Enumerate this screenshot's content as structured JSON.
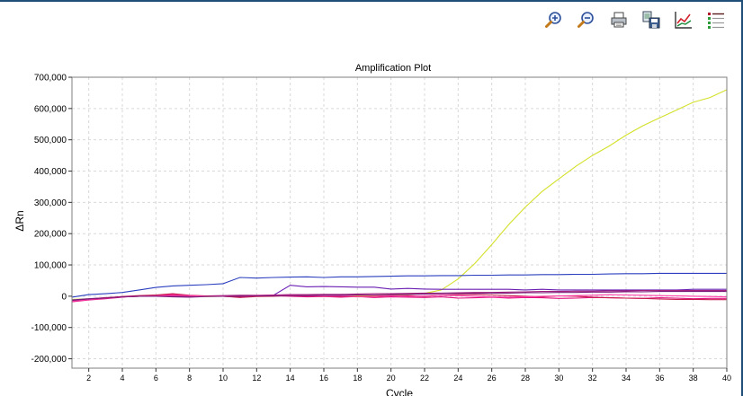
{
  "toolbar": {
    "icons": [
      "zoom-in-icon",
      "zoom-out-icon",
      "print-icon",
      "save-icon",
      "plot-settings-icon",
      "legend-icon"
    ]
  },
  "colors": {
    "grid": "#d9d9d9",
    "frame": "#000000",
    "background": "#ffffff"
  },
  "chart_data": {
    "type": "line",
    "title": "Amplification Plot",
    "xlabel": "Cycle",
    "ylabel": "ΔRn",
    "xlim": [
      1,
      40
    ],
    "ylim": [
      -230000,
      700000
    ],
    "xticks": [
      2,
      4,
      6,
      8,
      10,
      12,
      14,
      16,
      18,
      20,
      22,
      24,
      26,
      28,
      30,
      32,
      34,
      36,
      38,
      40
    ],
    "yticks": [
      -200000,
      -100000,
      0,
      100000,
      200000,
      300000,
      400000,
      500000,
      600000,
      700000
    ],
    "ytick_labels": [
      "-200,000",
      "-100,000",
      "0",
      "100,000",
      "200,000",
      "300,000",
      "400,000",
      "500,000",
      "600,000",
      "700,000"
    ],
    "grid": true,
    "legend": "none",
    "series": [
      {
        "color": "#d4e02a",
        "x": [
          1,
          2,
          3,
          4,
          5,
          6,
          7,
          8,
          9,
          10,
          11,
          12,
          13,
          14,
          15,
          16,
          17,
          18,
          19,
          20,
          21,
          22,
          23,
          24,
          25,
          26,
          27,
          28,
          29,
          30,
          31,
          32,
          33,
          34,
          35,
          36,
          37,
          38,
          39,
          40
        ],
        "y": [
          -10000,
          -8000,
          -6000,
          -2000,
          0,
          1000,
          2000,
          0,
          -1000,
          0,
          1000,
          0,
          1000,
          2000,
          0,
          -1000,
          0,
          1000,
          2000,
          3000,
          5000,
          9000,
          20000,
          55000,
          105000,
          165000,
          228000,
          285000,
          335000,
          375000,
          415000,
          450000,
          480000,
          515000,
          545000,
          570000,
          595000,
          620000,
          635000,
          660000
        ]
      },
      {
        "color": "#2b3fbf",
        "x": [
          1,
          2,
          3,
          4,
          5,
          6,
          7,
          8,
          9,
          10,
          11,
          12,
          13,
          14,
          15,
          16,
          17,
          18,
          19,
          20,
          21,
          22,
          23,
          24,
          25,
          26,
          27,
          28,
          29,
          30,
          31,
          32,
          33,
          34,
          35,
          36,
          37,
          38,
          39,
          40
        ],
        "y": [
          -3000,
          5000,
          8000,
          12000,
          20000,
          28000,
          33000,
          35000,
          37000,
          40000,
          60000,
          58000,
          60000,
          61000,
          62000,
          60000,
          62000,
          62000,
          63000,
          64000,
          65000,
          65000,
          66000,
          66000,
          67000,
          67000,
          68000,
          68000,
          69000,
          69000,
          70000,
          70000,
          71000,
          72000,
          72000,
          73000,
          73000,
          73000,
          73000,
          73000
        ]
      },
      {
        "color": "#6a1fb3",
        "x": [
          1,
          2,
          3,
          4,
          5,
          6,
          7,
          8,
          9,
          10,
          11,
          12,
          13,
          14,
          15,
          16,
          17,
          18,
          19,
          20,
          21,
          22,
          23,
          24,
          25,
          26,
          27,
          28,
          29,
          30,
          31,
          32,
          33,
          34,
          35,
          36,
          37,
          38,
          39,
          40
        ],
        "y": [
          -12000,
          -8000,
          -5000,
          -2000,
          0,
          0,
          0,
          0,
          1000,
          1000,
          2000,
          2000,
          3000,
          35000,
          30000,
          31000,
          30000,
          29000,
          29000,
          23000,
          25000,
          23000,
          22000,
          22000,
          22000,
          22000,
          22000,
          20000,
          22000,
          20000,
          20000,
          20000,
          20000,
          20000,
          20000,
          20000,
          20000,
          22000,
          22000,
          22000
        ]
      },
      {
        "color": "#a0207a",
        "x": [
          1,
          2,
          3,
          4,
          5,
          6,
          7,
          8,
          9,
          10,
          11,
          12,
          13,
          14,
          15,
          16,
          17,
          18,
          19,
          20,
          21,
          22,
          23,
          24,
          25,
          26,
          27,
          28,
          29,
          30,
          31,
          32,
          33,
          34,
          35,
          36,
          37,
          38,
          39,
          40
        ],
        "y": [
          -15000,
          -10000,
          -6000,
          -2000,
          0,
          2000,
          1000,
          0,
          1000,
          2000,
          3000,
          3000,
          4000,
          5000,
          5000,
          6000,
          6000,
          7000,
          8000,
          8000,
          9000,
          10000,
          10000,
          11000,
          12000,
          12000,
          13000,
          14000,
          15000,
          15000,
          16000,
          16000,
          17000,
          17000,
          18000,
          18000,
          18000,
          18000,
          18000,
          18000
        ]
      },
      {
        "color": "#e0117f",
        "x": [
          1,
          2,
          3,
          4,
          5,
          6,
          7,
          8,
          9,
          10,
          11,
          12,
          13,
          14,
          15,
          16,
          17,
          18,
          19,
          20,
          21,
          22,
          23,
          24,
          25,
          26,
          27,
          28,
          29,
          30,
          31,
          32,
          33,
          34,
          35,
          36,
          37,
          38,
          39,
          40
        ],
        "y": [
          -18000,
          -12000,
          -8000,
          -3000,
          1000,
          3000,
          6000,
          2000,
          0,
          0,
          -3000,
          1000,
          2000,
          0,
          -2000,
          -1000,
          -3000,
          -1000,
          -4000,
          -2000,
          -3000,
          -4000,
          -2000,
          -6000,
          -5000,
          -3000,
          -6000,
          -4000,
          -5000,
          -7000,
          -6000,
          -4000,
          -5000,
          -6000,
          -7000,
          -5000,
          -6000,
          -8000,
          -7000,
          -7000
        ]
      },
      {
        "color": "#c71d4e",
        "x": [
          1,
          2,
          3,
          4,
          5,
          6,
          7,
          8,
          9,
          10,
          11,
          12,
          13,
          14,
          15,
          16,
          17,
          18,
          19,
          20,
          21,
          22,
          23,
          24,
          25,
          26,
          27,
          28,
          29,
          30,
          31,
          32,
          33,
          34,
          35,
          36,
          37,
          38,
          39,
          40
        ],
        "y": [
          -14000,
          -9000,
          -5000,
          -1000,
          2000,
          4000,
          8000,
          3000,
          1000,
          0,
          -4000,
          -1000,
          0,
          2000,
          1000,
          -1000,
          0,
          -2000,
          -1000,
          1000,
          2000,
          0,
          3000,
          5000,
          6000,
          4000,
          2000,
          0,
          -2000,
          1000,
          0,
          -3000,
          -5000,
          -6000,
          -7000,
          -9000,
          -10000,
          -10000,
          -11000,
          -11000
        ]
      },
      {
        "color": "#ff3ca8",
        "x": [
          1,
          2,
          3,
          4,
          5,
          6,
          7,
          8,
          9,
          10,
          11,
          12,
          13,
          14,
          15,
          16,
          17,
          18,
          19,
          20,
          21,
          22,
          23,
          24,
          25,
          26,
          27,
          28,
          29,
          30,
          31,
          32,
          33,
          34,
          35,
          36,
          37,
          38,
          39,
          40
        ],
        "y": [
          -16000,
          -11000,
          -7000,
          -2000,
          0,
          1000,
          3000,
          2000,
          0,
          1000,
          0,
          2000,
          1000,
          3000,
          2000,
          0,
          1000,
          -1000,
          0,
          2000,
          0,
          1000,
          3000,
          2000,
          0,
          -2000,
          -3000,
          -2000,
          0,
          1000,
          2000,
          3000,
          5000,
          4000,
          3000,
          2000,
          1000,
          0,
          -1000,
          -2000
        ]
      },
      {
        "color": "#7a1b7a",
        "x": [
          1,
          2,
          3,
          4,
          5,
          6,
          7,
          8,
          9,
          10,
          11,
          12,
          13,
          14,
          15,
          16,
          17,
          18,
          19,
          20,
          21,
          22,
          23,
          24,
          25,
          26,
          27,
          28,
          29,
          30,
          31,
          32,
          33,
          34,
          35,
          36,
          37,
          38,
          39,
          40
        ],
        "y": [
          -13000,
          -9000,
          -6000,
          -2000,
          0,
          0,
          -2000,
          -3000,
          -1000,
          0,
          0,
          1000,
          1000,
          2000,
          2000,
          3000,
          3000,
          4000,
          4000,
          5000,
          6000,
          7000,
          8000,
          9000,
          9000,
          10000,
          10000,
          11000,
          11000,
          12000,
          12000,
          13000,
          13000,
          14000,
          14000,
          15000,
          15000,
          15000,
          15000,
          15000
        ]
      }
    ]
  }
}
